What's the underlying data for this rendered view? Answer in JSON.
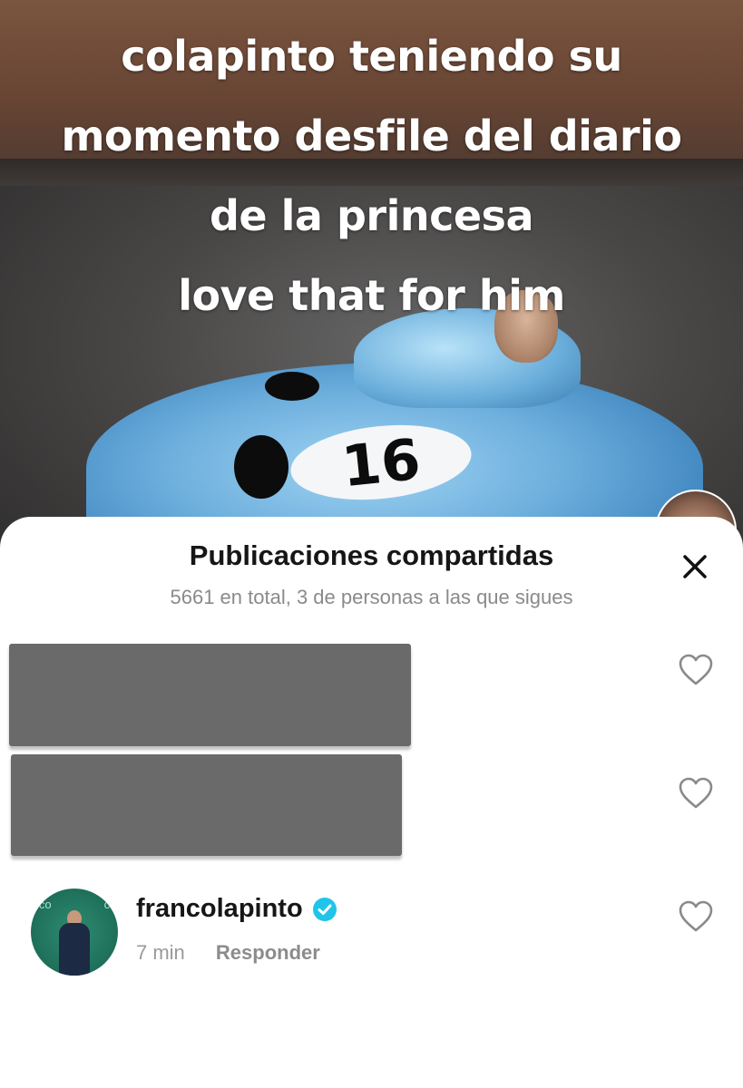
{
  "video": {
    "caption_lines": [
      "colapinto teniendo su",
      "momento desfile del diario",
      "de la princesa",
      "love that for him"
    ],
    "car_number": "16"
  },
  "sheet": {
    "title": "Publicaciones compartidas",
    "subtitle": "5661 en total, 3 de personas a las que sigues",
    "close_icon": "close-icon"
  },
  "comments": [
    {
      "username": "francolapinto",
      "verified": true,
      "time": "7 min",
      "reply_label": "Responder",
      "avatar_logo_left": "ico",
      "avatar_logo_right": "ci"
    }
  ],
  "colors": {
    "verified_badge": "#20c4e8",
    "redaction": "#6a6a6a",
    "heart_stroke": "#8a8a8a"
  }
}
